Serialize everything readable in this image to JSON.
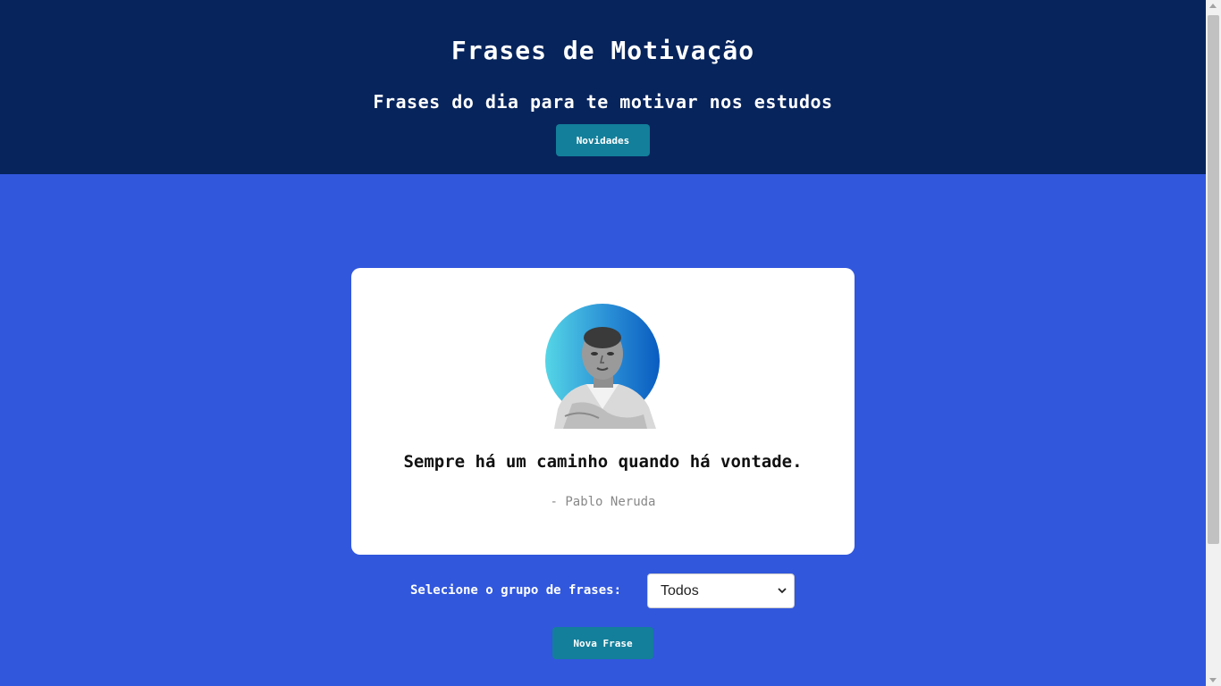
{
  "header": {
    "title": "Frases de Motivação",
    "subtitle": "Frases do dia para te motivar nos estudos",
    "news_button_label": "Novidades"
  },
  "quote_card": {
    "text": "Sempre há um caminho quando há vontade.",
    "author": "- Pablo Neruda"
  },
  "group_selector": {
    "label": "Selecione o grupo de frases:",
    "selected_value": "Todos"
  },
  "new_quote_button_label": "Nova Frase",
  "colors": {
    "header_background": "#07245c",
    "page_background": "#3157dd",
    "button_background": "#137f9a",
    "card_background": "#ffffff",
    "author_text": "#888888"
  }
}
